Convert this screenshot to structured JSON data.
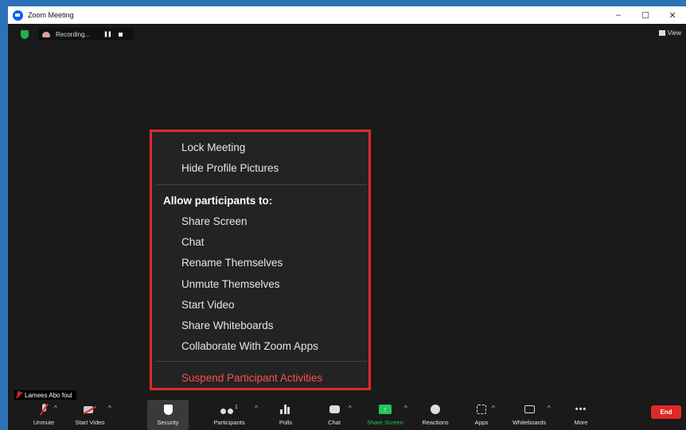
{
  "window": {
    "title": "Zoom Meeting",
    "controls": {
      "minimize": "–",
      "maximize": "☐",
      "close": "✕"
    }
  },
  "topbar": {
    "recording_text": "Recording...",
    "pause_icon": "❚❚",
    "view_label": "View"
  },
  "security_menu": {
    "items_top": [
      "Lock Meeting",
      "Hide Profile Pictures"
    ],
    "heading": "Allow participants to:",
    "allow_items": [
      "Share Screen",
      "Chat",
      "Rename Themselves",
      "Unmute Themselves",
      "Start Video",
      "Share Whiteboards",
      "Collaborate With Zoom Apps"
    ],
    "suspend": "Suspend Participant Activities",
    "highlight_color": "#e0292d"
  },
  "participant_name": "Lamees Abo foul",
  "toolbar": {
    "unmute": "Unmute",
    "start_video": "Start Video",
    "security": "Security",
    "participants": "Participants",
    "participants_count": "1",
    "polls": "Polls",
    "chat": "Chat",
    "share_screen": "Share Screen",
    "reactions": "Reactions",
    "apps": "Apps",
    "whiteboards": "Whiteboards",
    "more": "More",
    "more_icon": "•••",
    "end": "End",
    "caret": "^",
    "share_arrow": "↑"
  },
  "colors": {
    "background": "#1a1a1a",
    "end_red": "#e02828",
    "share_green": "#22c55e",
    "desktop_blue": "#2b73b6"
  }
}
